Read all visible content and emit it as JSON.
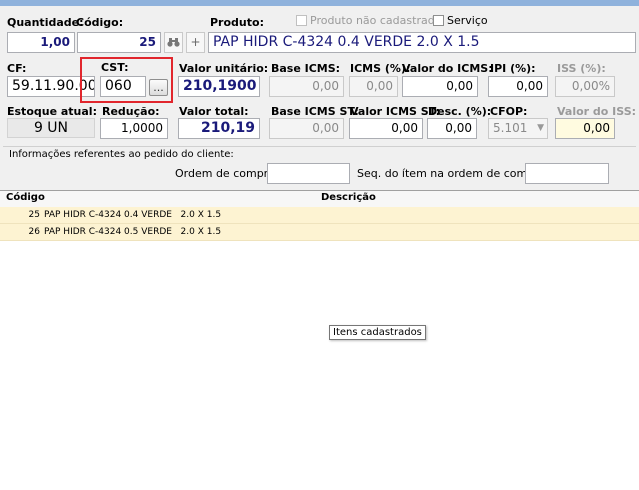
{
  "colors": {
    "accent_blue": "#1a1a7a",
    "highlight_red": "#e1262d",
    "row_yellow": "#fdf3d2"
  },
  "header": {
    "quantidade_label": "Quantidade:",
    "codigo_label": "Código:",
    "produto_label": "Produto:",
    "nao_cadastrado_label": "Produto não cadastrado",
    "servico_label": "Serviço"
  },
  "fields": {
    "quantidade": "1,00",
    "codigo": "25",
    "produto": "PAP HIDR C-4324 0.4 VERDE   2.0 X 1.5"
  },
  "row2": {
    "cf_label": "CF:",
    "cf": "59.11.90.00",
    "cst_label": "CST:",
    "cst": "060",
    "cst_button": "...",
    "valor_unitario_label": "Valor unitário:",
    "valor_unitario": "210,1900",
    "base_icms_label": "Base ICMS:",
    "base_icms": "0,00",
    "icms_pct_label": "ICMS (%):",
    "icms_pct": "0,00",
    "valor_icms_label": "Valor do ICMS:",
    "valor_icms": "0,00",
    "ipi_label": "IPI (%):",
    "ipi": "0,00",
    "iss_label": "ISS (%):",
    "iss": "0,00%"
  },
  "row3": {
    "estoque_label": "Estoque atual:",
    "estoque": "9 UN",
    "reducao_label": "Redução:",
    "reducao": "1,0000",
    "valor_total_label": "Valor total:",
    "valor_total": "210,19",
    "base_icms_st_label": "Base ICMS ST:",
    "base_icms_st": "0,00",
    "valor_icms_st_label": "Valor ICMS ST:",
    "valor_icms_st": "0,00",
    "desc_label": "Desc. (%):",
    "desc": "0,00",
    "cfop_label": "CFOP:",
    "cfop": "5.101",
    "valor_iss_label": "Valor do ISS:",
    "valor_iss": "0,00"
  },
  "pedido": {
    "title": "Informações referentes ao pedido do cliente:",
    "ordem_label": "Ordem de compra:",
    "seq_label": "Seq. do ítem na ordem de compra:",
    "ordem_value": "",
    "seq_value": ""
  },
  "grid": {
    "col_codigo": "Código",
    "col_descricao": "Descrição",
    "rows": [
      {
        "codigo": "25",
        "descricao": "PAP HIDR C-4324 0.4 VERDE   2.0 X 1.5"
      },
      {
        "codigo": "26",
        "descricao": "PAP HIDR C-4324 0.5 VERDE   2.0 X 1.5"
      }
    ]
  },
  "tooltip": "Itens cadastrados",
  "icons": {
    "binoculars": "binoculars-icon",
    "plus": "plus-icon",
    "dropdown": "chevron-down-icon"
  }
}
